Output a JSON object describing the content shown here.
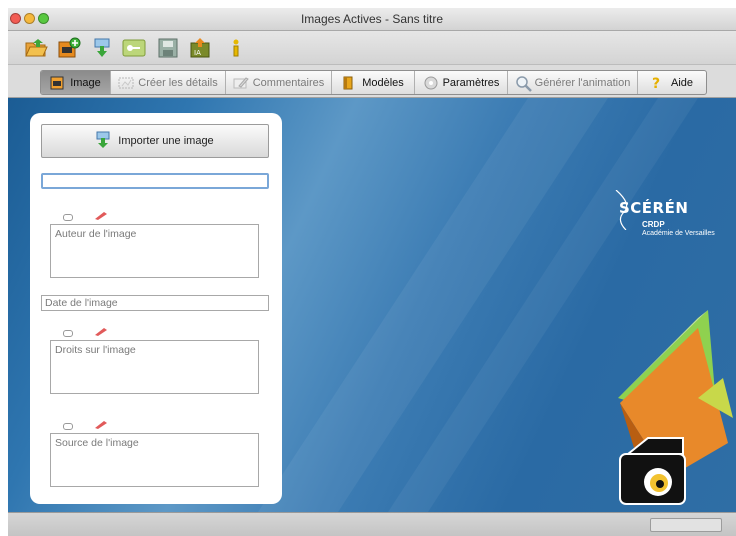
{
  "window": {
    "title": "Images Actives  -  Sans titre"
  },
  "toolbar": {
    "icons": [
      "open-folder-icon",
      "new-project-icon",
      "import-icon",
      "key-icon",
      "save-icon",
      "export-icon",
      "info-icon"
    ]
  },
  "tabs": [
    {
      "label": "Image",
      "icon": "image-icon",
      "active": true,
      "enabled": true
    },
    {
      "label": "Créer les détails",
      "icon": "details-icon",
      "active": false,
      "enabled": false
    },
    {
      "label": "Commentaires",
      "icon": "pencil-icon",
      "active": false,
      "enabled": false
    },
    {
      "label": "Modèles",
      "icon": "book-icon",
      "active": false,
      "enabled": true
    },
    {
      "label": "Paramètres",
      "icon": "gear-icon",
      "active": false,
      "enabled": true
    },
    {
      "label": "Générer l'animation",
      "icon": "magnifier-icon",
      "active": false,
      "enabled": false
    },
    {
      "label": "Aide",
      "icon": "help-icon",
      "active": false,
      "enabled": true
    }
  ],
  "panel": {
    "import_label": "Importer une image",
    "title_value": "",
    "author_placeholder": "Auteur de l'image",
    "date_placeholder": "Date de l'image",
    "rights_placeholder": "Droits sur l'image",
    "source_placeholder": "Source de l'image"
  },
  "logo": {
    "wordmark": "SCÉRÉN",
    "org": "CRDP",
    "academy": "Académie de Versailles"
  },
  "colors": {
    "background_blue": "#2f6ea5",
    "accent_green": "#8fd14f",
    "accent_orange": "#e8892a"
  }
}
